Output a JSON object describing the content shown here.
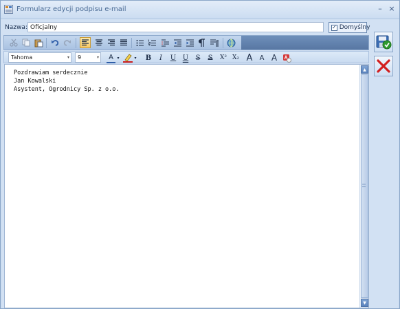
{
  "window": {
    "title": "Formularz edycji podpisu e-mail",
    "minimize_glyph": "–",
    "close_glyph": "×"
  },
  "form": {
    "name_label": "Nazwa:",
    "name_value": "Oficjalny",
    "default_label": "Domyślny",
    "default_checked": true,
    "check_glyph": "✓"
  },
  "toolbar": {
    "icons": [
      "cut-icon",
      "copy-icon",
      "paste-icon",
      "undo-icon",
      "redo-icon",
      "align-left-icon",
      "align-center-icon",
      "align-right-icon",
      "justify-icon",
      "bullet-list-icon",
      "numbered-list-icon",
      "multilevel-list-icon",
      "decrease-indent-icon",
      "increase-indent-icon",
      "paragraph-icon",
      "show-formatting-icon",
      "insert-link-icon"
    ]
  },
  "format": {
    "font_name": "Tahoma",
    "font_size": "9",
    "dropdown_glyph": "▾",
    "font_color_label": "A",
    "bold_label": "B",
    "italic_label": "I",
    "underline_label": "U",
    "double_underline_label": "U",
    "strike_label": "S",
    "double_strike_label": "S",
    "superscript_label": "X²",
    "subscript_label": "X₂",
    "grow_font_label": "A",
    "shrink_font_label": "A",
    "change_case_label": "A"
  },
  "editor": {
    "text": "Pozdrawiam serdecznie\nJan Kowalski\nAsystent, Ogrodnicy Sp. z o.o."
  },
  "side": {
    "save_icon": "save-icon",
    "cancel_icon": "cancel-icon"
  },
  "colors": {
    "accent": "#5877a3",
    "save_green": "#2f9a2f",
    "cancel_red": "#d21f1f"
  }
}
